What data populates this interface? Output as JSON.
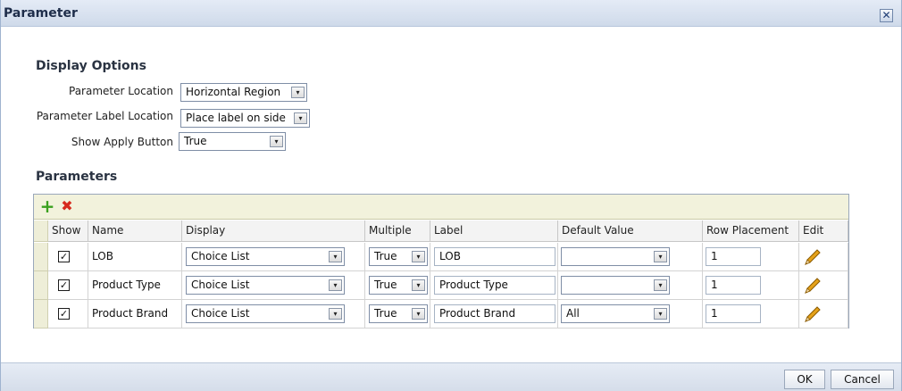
{
  "dialog": {
    "title": "Parameter",
    "close_icon": "close-icon",
    "close_glyph": "✕"
  },
  "display_options": {
    "heading": "Display Options",
    "rows": [
      {
        "label": "Parameter Location",
        "value": "Horizontal Region"
      },
      {
        "label": "Parameter Label Location",
        "value": "Place label on side"
      },
      {
        "label": "Show Apply Button",
        "value": "True"
      }
    ]
  },
  "parameters": {
    "heading": "Parameters",
    "toolbar": {
      "add_icon": "plus-icon",
      "add_glyph": "+",
      "delete_icon": "delete-x-icon",
      "delete_glyph": "✖"
    },
    "columns": [
      "Show",
      "Name",
      "Display",
      "Multiple",
      "Label",
      "Default Value",
      "Row Placement",
      "Edit"
    ],
    "rows": [
      {
        "show": true,
        "show_glyph": "✓",
        "name": "LOB",
        "display": "Choice List",
        "multiple": "True",
        "label": "LOB",
        "default_value": "",
        "row_placement": "1"
      },
      {
        "show": true,
        "show_glyph": "✓",
        "name": "Product Type",
        "display": "Choice List",
        "multiple": "True",
        "label": "Product Type",
        "default_value": "",
        "row_placement": "1"
      },
      {
        "show": true,
        "show_glyph": "✓",
        "name": "Product Brand",
        "display": "Choice List",
        "multiple": "True",
        "label": "Product Brand",
        "default_value": "All",
        "row_placement": "1"
      }
    ]
  },
  "footer": {
    "ok_label": "OK",
    "cancel_label": "Cancel"
  },
  "icons": {
    "dropdown_arrow": "▾",
    "edit": "pencil-icon"
  },
  "colors": {
    "add": "#3aa01e",
    "delete": "#d62a1e",
    "pencil": "#d58a00"
  }
}
